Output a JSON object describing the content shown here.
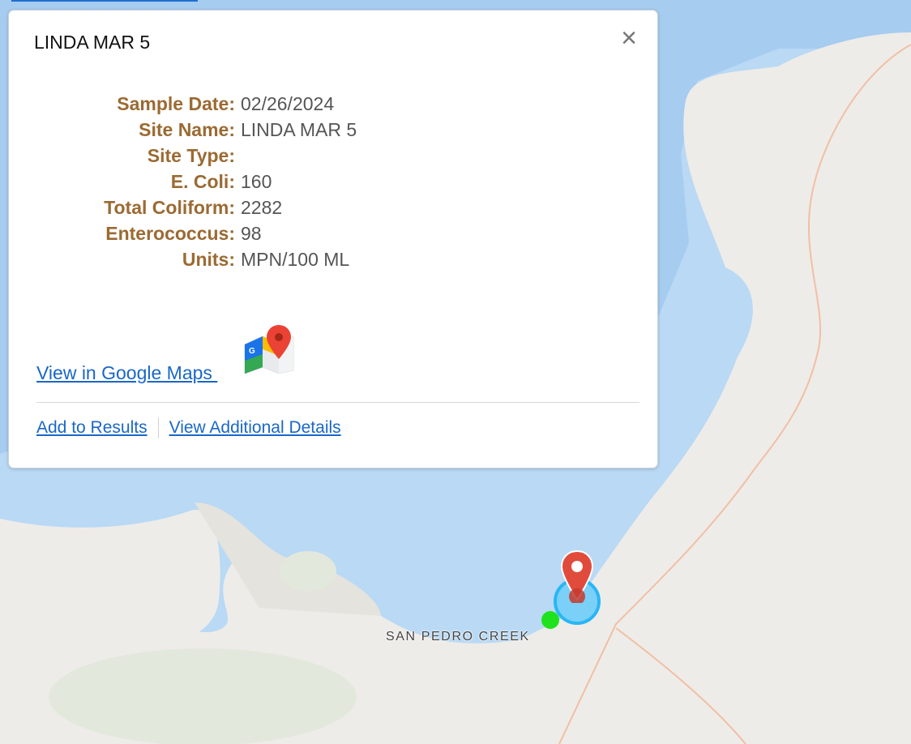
{
  "popup": {
    "title": "LINDA MAR 5",
    "close_symbol": "×",
    "attributes": [
      {
        "label": "Sample Date:",
        "value": "02/26/2024"
      },
      {
        "label": "Site Name:",
        "value": "LINDA MAR 5"
      },
      {
        "label": "Site Type:",
        "value": ""
      },
      {
        "label": "E. Coli:",
        "value": "160"
      },
      {
        "label": "Total Coliform:",
        "value": "2282"
      },
      {
        "label": "Enterococcus:",
        "value": "98"
      },
      {
        "label": "Units:",
        "value": "MPN/100 ML"
      }
    ],
    "google_maps_link": "View in Google Maps ",
    "google_maps_icon": "google-maps-icon",
    "actions": {
      "add_to_results": "Add to Results",
      "view_additional_details": "View Additional Details"
    }
  },
  "map": {
    "place_label": "SAN PEDRO CREEK",
    "colors": {
      "water": "#b9d9f5",
      "deep_water": "#9fc8ef",
      "land": "#eeece8",
      "road": "#f1bfa4",
      "pin": "#e04b3c",
      "ring": "#29b6f6",
      "sample_dot": "#1fe21f"
    }
  }
}
